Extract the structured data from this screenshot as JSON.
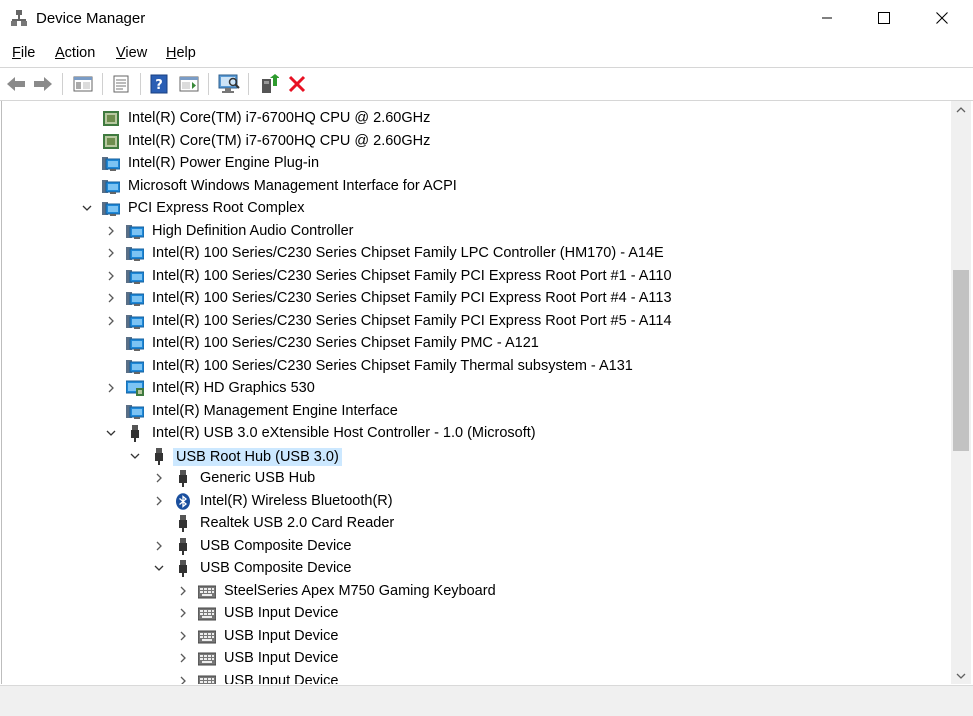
{
  "window": {
    "title": "Device Manager",
    "controls": [
      "minimize",
      "maximize",
      "close"
    ]
  },
  "menu": {
    "file": {
      "u": "F",
      "rest": "ile"
    },
    "action": {
      "u": "A",
      "rest": "ction"
    },
    "view": {
      "u": "V",
      "rest": "iew"
    },
    "help": {
      "u": "H",
      "rest": "elp"
    }
  },
  "toolbar": {
    "icons": [
      "back-arrow-icon",
      "forward-arrow-icon",
      "show-hide-console-tree-icon",
      "properties-icon",
      "help-icon",
      "action-pane-icon",
      "scan-hardware-icon",
      "update-driver-icon",
      "uninstall-device-icon"
    ]
  },
  "tree": {
    "rows": [
      {
        "label": "Intel(R) Core(TM) i7-6700HQ CPU @ 2.60GHz",
        "expander": "none",
        "icon": "processor-icon"
      },
      {
        "label": "Intel(R) Core(TM) i7-6700HQ CPU @ 2.60GHz",
        "expander": "none",
        "icon": "processor-icon"
      },
      {
        "label": "Intel(R) Power Engine Plug-in",
        "expander": "none",
        "icon": "system-device-icon"
      },
      {
        "label": "Microsoft Windows Management Interface for ACPI",
        "expander": "none",
        "icon": "system-device-icon"
      },
      {
        "label": "PCI Express Root Complex",
        "expander": "expanded",
        "icon": "system-device-icon"
      },
      {
        "label": "High Definition Audio Controller",
        "expander": "collapsed",
        "icon": "system-device-icon"
      },
      {
        "label": "Intel(R) 100 Series/C230 Series Chipset Family LPC Controller (HM170) - A14E",
        "expander": "collapsed",
        "icon": "system-device-icon"
      },
      {
        "label": "Intel(R) 100 Series/C230 Series Chipset Family PCI Express Root Port #1 - A110",
        "expander": "collapsed",
        "icon": "system-device-icon"
      },
      {
        "label": "Intel(R) 100 Series/C230 Series Chipset Family PCI Express Root Port #4 - A113",
        "expander": "collapsed",
        "icon": "system-device-icon"
      },
      {
        "label": "Intel(R) 100 Series/C230 Series Chipset Family PCI Express Root Port #5 - A114",
        "expander": "collapsed",
        "icon": "system-device-icon"
      },
      {
        "label": "Intel(R) 100 Series/C230 Series Chipset Family PMC - A121",
        "expander": "none",
        "icon": "system-device-icon"
      },
      {
        "label": "Intel(R) 100 Series/C230 Series Chipset Family Thermal subsystem - A131",
        "expander": "none",
        "icon": "system-device-icon"
      },
      {
        "label": "Intel(R) HD Graphics 530",
        "expander": "collapsed",
        "icon": "display-adapter-icon"
      },
      {
        "label": "Intel(R) Management Engine Interface",
        "expander": "none",
        "icon": "system-device-icon"
      },
      {
        "label": "Intel(R) USB 3.0 eXtensible Host Controller - 1.0 (Microsoft)",
        "expander": "expanded",
        "icon": "usb-plug-icon"
      },
      {
        "label": "USB Root Hub (USB 3.0)",
        "expander": "expanded",
        "icon": "usb-plug-icon"
      },
      {
        "label": "Generic USB Hub",
        "expander": "collapsed",
        "icon": "usb-plug-icon"
      },
      {
        "label": "Intel(R) Wireless Bluetooth(R)",
        "expander": "collapsed",
        "icon": "bluetooth-icon"
      },
      {
        "label": "Realtek USB 2.0 Card Reader",
        "expander": "none",
        "icon": "usb-plug-icon"
      },
      {
        "label": "USB Composite Device",
        "expander": "collapsed",
        "icon": "usb-plug-icon"
      },
      {
        "label": "USB Composite Device",
        "expander": "expanded",
        "icon": "usb-plug-icon"
      },
      {
        "label": "SteelSeries Apex M750 Gaming Keyboard",
        "expander": "collapsed",
        "icon": "keyboard-icon"
      },
      {
        "label": "USB Input Device",
        "expander": "collapsed",
        "icon": "keyboard-icon"
      },
      {
        "label": "USB Input Device",
        "expander": "collapsed",
        "icon": "keyboard-icon"
      },
      {
        "label": "USB Input Device",
        "expander": "collapsed",
        "icon": "keyboard-icon"
      },
      {
        "label": "USB Input Device",
        "expander": "collapsed",
        "icon": "keyboard-icon"
      }
    ],
    "selected_label": "USB Root Hub (USB 3.0)"
  },
  "colors": {
    "selection": "#cce8ff",
    "uninstall_red": "#e81123"
  }
}
